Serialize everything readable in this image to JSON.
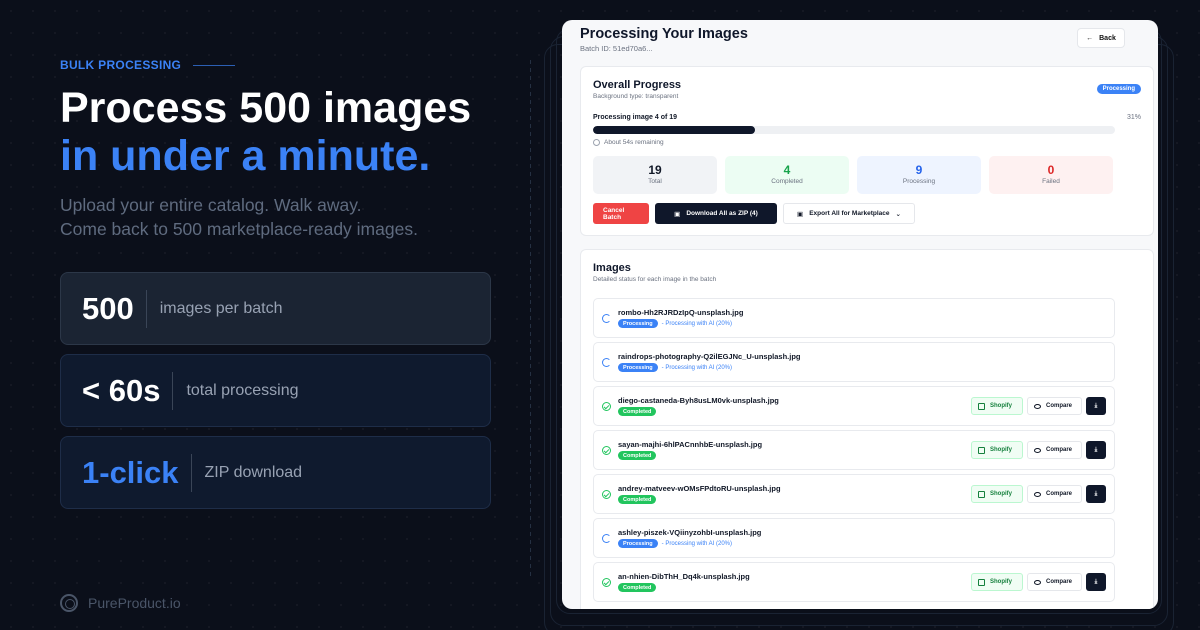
{
  "hero": {
    "eyebrow": "BULK PROCESSING",
    "headline_line1": "Process 500 images",
    "headline_line2": "in under a minute.",
    "sub_line1": "Upload your entire catalog. Walk away.",
    "sub_line2": "Come back to 500 marketplace-ready images."
  },
  "stats": [
    {
      "value": "500",
      "label": "images per batch"
    },
    {
      "value": "< 60s",
      "label": "total processing"
    },
    {
      "value": "1-click",
      "label": "ZIP download"
    }
  ],
  "brand": {
    "name": "PureProduct.io"
  },
  "panel": {
    "title": "Processing Your Images",
    "batch": "Batch ID: 51ed70a6...",
    "back_label": "Back",
    "overall": {
      "title": "Overall Progress",
      "subtitle": "Background type: transparent",
      "status_badge": "Processing",
      "progress_label": "Processing image 4 of 19",
      "progress_pct": "31%",
      "progress_value": 0.31,
      "remaining": "About 54s remaining",
      "tiles": [
        {
          "value": "19",
          "label": "Total"
        },
        {
          "value": "4",
          "label": "Completed"
        },
        {
          "value": "9",
          "label": "Processing"
        },
        {
          "value": "0",
          "label": "Failed"
        }
      ],
      "cancel_label": "Cancel Batch",
      "zip_label": "Download All as ZIP (4)",
      "export_label": "Export All for Marketplace"
    },
    "images": {
      "title": "Images",
      "subtitle": "Detailed status for each image in the batch",
      "shopify_label": "Shopify",
      "compare_label": "Compare",
      "rows": [
        {
          "name": "rombo-Hh2RJRDzIpQ-unsplash.jpg",
          "status": "Processing",
          "note": "- Processing with AI (20%)"
        },
        {
          "name": "raindrops-photography-Q2ilEGJNc_U-unsplash.jpg",
          "status": "Processing",
          "note": "- Processing with AI (20%)"
        },
        {
          "name": "diego-castaneda-Byh8usLM0vk-unsplash.jpg",
          "status": "Completed",
          "note": ""
        },
        {
          "name": "sayan-majhi-6hlPACnnhbE-unsplash.jpg",
          "status": "Completed",
          "note": ""
        },
        {
          "name": "andrey-matveev-wOMsFPdtoRU-unsplash.jpg",
          "status": "Completed",
          "note": ""
        },
        {
          "name": "ashley-piszek-VQiinyzohbI-unsplash.jpg",
          "status": "Processing",
          "note": "- Processing with AI (20%)"
        },
        {
          "name": "an-nhien-DibThH_Dq4k-unsplash.jpg",
          "status": "Completed",
          "note": ""
        }
      ]
    }
  },
  "colors": {
    "accent": "#3b82f6",
    "background": "#0b0f1a",
    "success": "#22c55e",
    "danger": "#ef4444"
  }
}
